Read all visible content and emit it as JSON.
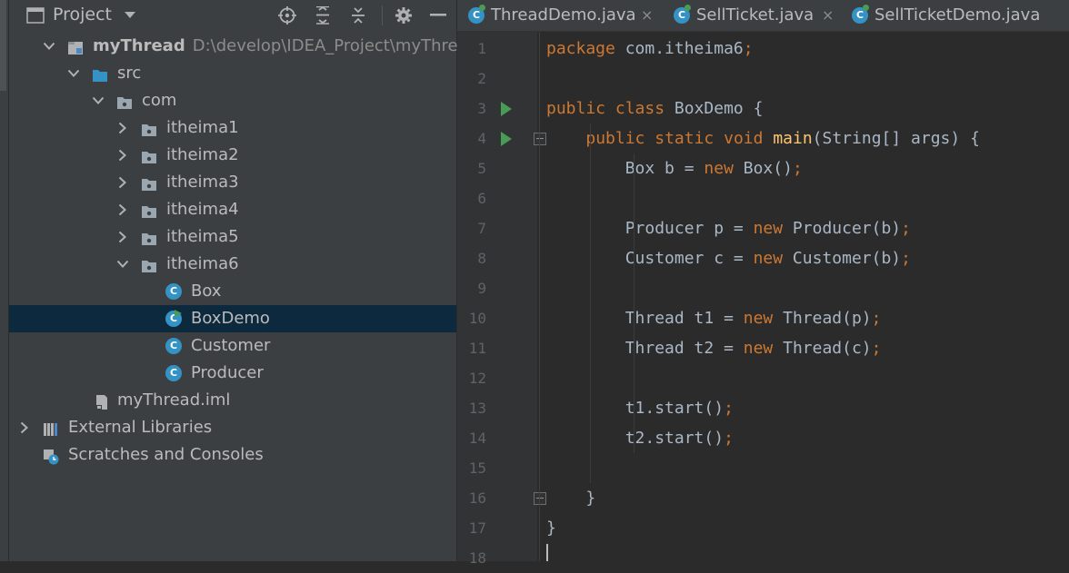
{
  "project_panel": {
    "title": "Project",
    "tree": [
      {
        "label": "myThread",
        "path": "D:\\develop\\IDEA_Project\\myThread",
        "type": "module",
        "expanded": true,
        "bold": true
      },
      {
        "label": "src",
        "type": "source-folder",
        "expanded": true
      },
      {
        "label": "com",
        "type": "package",
        "expanded": true
      },
      {
        "label": "itheima1",
        "type": "package",
        "expanded": false
      },
      {
        "label": "itheima2",
        "type": "package",
        "expanded": false
      },
      {
        "label": "itheima3",
        "type": "package",
        "expanded": false
      },
      {
        "label": "itheima4",
        "type": "package",
        "expanded": false
      },
      {
        "label": "itheima5",
        "type": "package",
        "expanded": false
      },
      {
        "label": "itheima6",
        "type": "package",
        "expanded": true
      },
      {
        "label": "Box",
        "type": "class"
      },
      {
        "label": "BoxDemo",
        "type": "class-main",
        "selected": true
      },
      {
        "label": "Customer",
        "type": "class"
      },
      {
        "label": "Producer",
        "type": "class"
      },
      {
        "label": "myThread.iml",
        "type": "iml-file"
      },
      {
        "label": "External Libraries",
        "type": "libraries",
        "expanded": false
      },
      {
        "label": "Scratches and Consoles",
        "type": "scratches"
      }
    ]
  },
  "tabs": [
    {
      "label": "ThreadDemo.java",
      "close": "×"
    },
    {
      "label": "SellTicket.java",
      "close": "×"
    },
    {
      "label": "SellTicketDemo.java",
      "close": ""
    }
  ],
  "editor": {
    "line_numbers": [
      "1",
      "2",
      "3",
      "4",
      "5",
      "6",
      "7",
      "8",
      "9",
      "10",
      "11",
      "12",
      "13",
      "14",
      "15",
      "16",
      "17",
      "18"
    ],
    "lines": [
      "package com.itheima6;",
      "",
      "public class BoxDemo {",
      "    public static void main(String[] args) {",
      "        Box b = new Box();",
      "",
      "        Producer p = new Producer(b);",
      "        Customer c = new Customer(b);",
      "",
      "        Thread t1 = new Thread(p);",
      "        Thread t2 = new Thread(c);",
      "",
      "        t1.start();",
      "        t2.start();",
      "",
      "    }",
      "}",
      ""
    ]
  },
  "colors": {
    "keyword": "#cc7832",
    "method": "#ffc66d",
    "text": "#a9b7c6",
    "selection": "#0d293e",
    "class_icon": "#3592c4",
    "run": "#499c54"
  }
}
